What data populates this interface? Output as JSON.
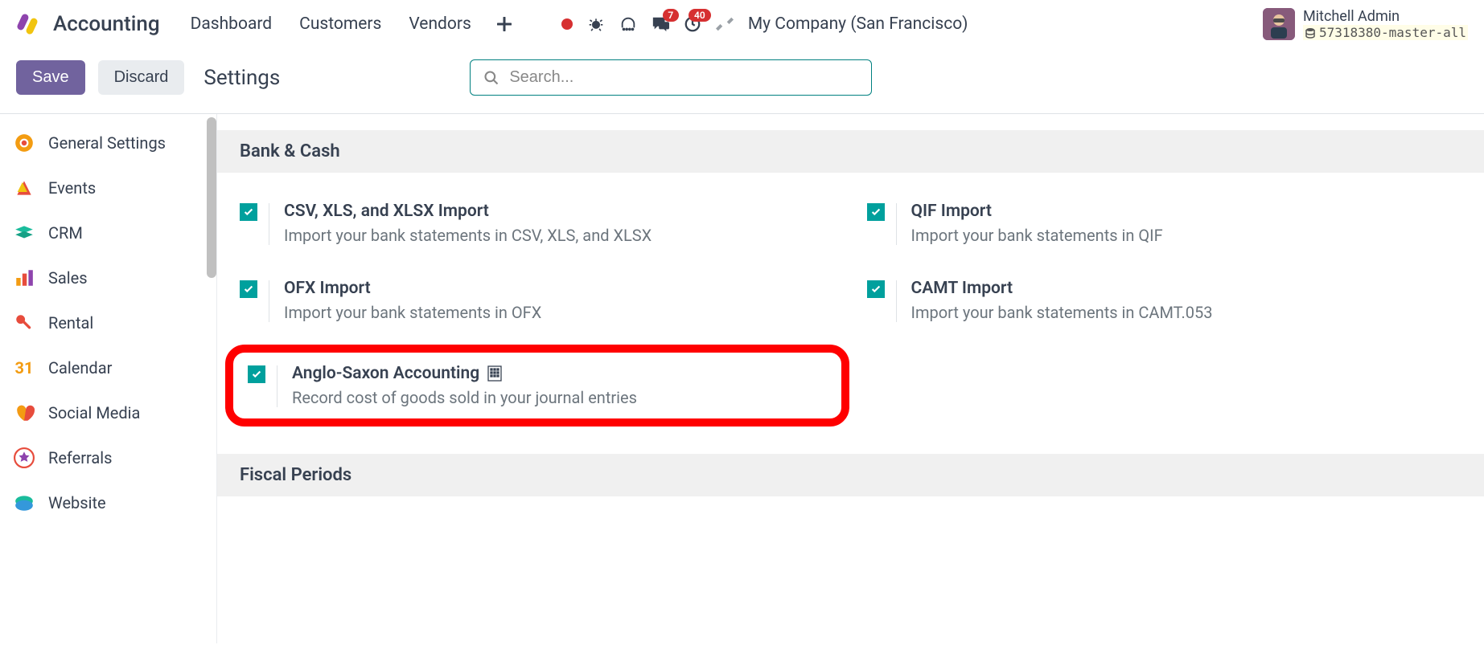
{
  "header": {
    "app_name": "Accounting",
    "menu": [
      "Dashboard",
      "Customers",
      "Vendors"
    ],
    "message_badge": "7",
    "activity_badge": "40",
    "company": "My Company (San Francisco)",
    "user_name": "Mitchell Admin",
    "db_name": "57318380-master-all"
  },
  "controlbar": {
    "save_label": "Save",
    "discard_label": "Discard",
    "page_title": "Settings",
    "search_placeholder": "Search..."
  },
  "sidebar": {
    "items": [
      {
        "label": "General Settings",
        "icon": "gear"
      },
      {
        "label": "Events",
        "icon": "events"
      },
      {
        "label": "CRM",
        "icon": "crm"
      },
      {
        "label": "Sales",
        "icon": "sales"
      },
      {
        "label": "Rental",
        "icon": "rental"
      },
      {
        "label": "Calendar",
        "icon": "calendar"
      },
      {
        "label": "Social Media",
        "icon": "social"
      },
      {
        "label": "Referrals",
        "icon": "referrals"
      },
      {
        "label": "Website",
        "icon": "website"
      }
    ]
  },
  "sections": {
    "bank_cash": {
      "title": "Bank & Cash",
      "settings": [
        {
          "title": "CSV, XLS, and XLSX Import",
          "desc": "Import your bank statements in CSV, XLS, and XLSX",
          "checked": true
        },
        {
          "title": "QIF Import",
          "desc": "Import your bank statements in QIF",
          "checked": true
        },
        {
          "title": "OFX Import",
          "desc": "Import your bank statements in OFX",
          "checked": true
        },
        {
          "title": "CAMT Import",
          "desc": "Import your bank statements in CAMT.053",
          "checked": true
        },
        {
          "title": "Anglo-Saxon Accounting",
          "desc": "Record cost of goods sold in your journal entries",
          "checked": true,
          "highlighted": true,
          "building_icon": true
        }
      ]
    },
    "fiscal_periods": {
      "title": "Fiscal Periods"
    }
  }
}
